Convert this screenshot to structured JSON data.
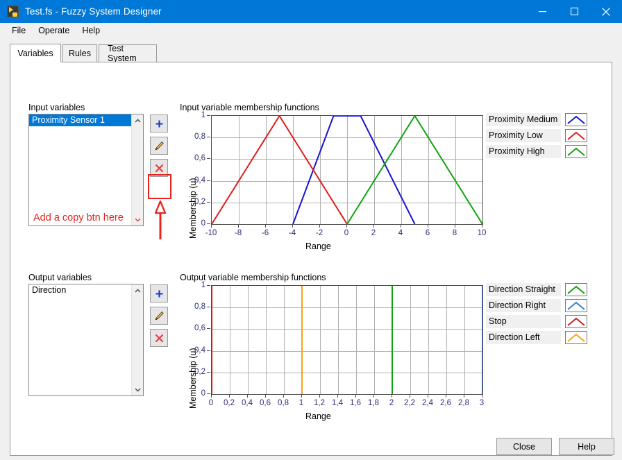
{
  "window": {
    "title": "Test.fs - Fuzzy System Designer",
    "icon": "fuzzy-designer-icon",
    "controls": [
      {
        "name": "minimize-button",
        "glyph": "minimize-icon"
      },
      {
        "name": "maximize-button",
        "glyph": "maximize-icon"
      },
      {
        "name": "close-button",
        "glyph": "close-icon"
      }
    ]
  },
  "menubar": {
    "items": [
      {
        "label": "File"
      },
      {
        "label": "Operate"
      },
      {
        "label": "Help"
      }
    ]
  },
  "tabs": [
    {
      "label": "Variables",
      "active": true
    },
    {
      "label": "Rules",
      "active": false
    },
    {
      "label": "Test System",
      "active": false
    }
  ],
  "input_section": {
    "group_label": "Input variables",
    "list": {
      "items": [
        {
          "label": "Proximity Sensor 1",
          "selected": true
        }
      ]
    },
    "buttons": [
      {
        "name": "add-input-variable-button",
        "icon": "plus-icon"
      },
      {
        "name": "edit-input-variable-button",
        "icon": "pencil-icon"
      },
      {
        "name": "delete-input-variable-button",
        "icon": "x-icon"
      }
    ],
    "annotation": {
      "box_label": "copy-button-placeholder",
      "text": "Add a copy btn here",
      "arrow": "up-arrow-annotation",
      "color": "#e8241f"
    }
  },
  "output_section": {
    "group_label": "Output variables",
    "list": {
      "items": [
        {
          "label": "Direction",
          "selected": false
        }
      ]
    },
    "buttons": [
      {
        "name": "add-output-variable-button",
        "icon": "plus-icon"
      },
      {
        "name": "edit-output-variable-button",
        "icon": "pencil-icon"
      },
      {
        "name": "delete-output-variable-button",
        "icon": "x-icon"
      }
    ]
  },
  "footer": {
    "close_label": "Close",
    "help_label": "Help"
  },
  "chart_data": [
    {
      "id": "input-chart",
      "type": "line",
      "title": "Input variable membership functions",
      "xlabel": "Range",
      "ylabel": "Membership (u)",
      "xlim": [
        -10,
        10
      ],
      "ylim": [
        0,
        1
      ],
      "xticks": [
        "-10",
        "-8",
        "-6",
        "-4",
        "-2",
        "0",
        "2",
        "4",
        "6",
        "8",
        "10"
      ],
      "xtick_values": [
        -10,
        -8,
        -6,
        -4,
        -2,
        0,
        2,
        4,
        6,
        8,
        10
      ],
      "yticks": [
        "0",
        "0,2",
        "0,4",
        "0,6",
        "0,8",
        "1"
      ],
      "ytick_values": [
        0,
        0.2,
        0.4,
        0.6,
        0.8,
        1
      ],
      "grid": true,
      "legend_position": "right",
      "series": [
        {
          "name": "Proximity Medium",
          "color": "#1414d2",
          "points": [
            [
              -4,
              0
            ],
            [
              -1,
              1
            ],
            [
              1,
              1
            ],
            [
              5,
              0
            ]
          ]
        },
        {
          "name": "Proximity Low",
          "color": "#e01b1b",
          "points": [
            [
              -10,
              0
            ],
            [
              -5,
              1
            ],
            [
              0,
              0
            ]
          ]
        },
        {
          "name": "Proximity High",
          "color": "#10a210",
          "points": [
            [
              0,
              0
            ],
            [
              5,
              1
            ],
            [
              10,
              0
            ]
          ]
        }
      ]
    },
    {
      "id": "output-chart",
      "type": "line",
      "title": "Output variable membership functions",
      "xlabel": "Range",
      "ylabel": "Membership (u)",
      "xlim": [
        0,
        3
      ],
      "ylim": [
        0,
        1
      ],
      "xticks": [
        "0",
        "0,2",
        "0,4",
        "0,6",
        "0,8",
        "1",
        "1,2",
        "1,4",
        "1,6",
        "1,8",
        "2",
        "2,2",
        "2,4",
        "2,6",
        "2,8",
        "3"
      ],
      "xtick_values": [
        0,
        0.2,
        0.4,
        0.6,
        0.8,
        1,
        1.2,
        1.4,
        1.6,
        1.8,
        2,
        2.2,
        2.4,
        2.6,
        2.8,
        3
      ],
      "yticks": [
        "0",
        "0,2",
        "0,4",
        "0,6",
        "0,8",
        "1"
      ],
      "ytick_values": [
        0,
        0.2,
        0.4,
        0.6,
        0.8,
        1
      ],
      "grid": true,
      "legend_position": "right",
      "series": [
        {
          "name": "Direction Straight",
          "color": "#10a210",
          "points": [
            [
              2,
              0
            ],
            [
              2,
              1
            ]
          ]
        },
        {
          "name": "Direction Right",
          "color": "#3c78dc",
          "points": [
            [
              3,
              0
            ],
            [
              3,
              1
            ]
          ]
        },
        {
          "name": "Stop",
          "color": "#c81e1e",
          "points": [
            [
              0,
              0
            ],
            [
              0,
              1
            ]
          ]
        },
        {
          "name": "Direction Left",
          "color": "#f5a318",
          "points": [
            [
              1,
              0
            ],
            [
              1,
              1
            ]
          ]
        }
      ]
    }
  ]
}
